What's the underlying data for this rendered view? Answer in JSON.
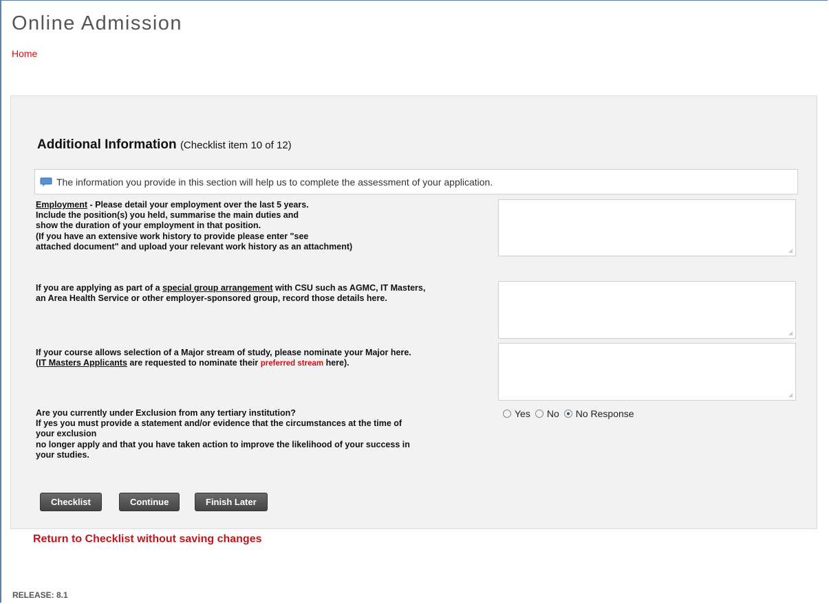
{
  "header": {
    "title": "Online Admission",
    "home_link": "Home"
  },
  "section": {
    "title": "Additional Information",
    "subtitle": "(Checklist item 10 of 12)",
    "info": "The information you provide in this section will help us to complete the assessment of your application."
  },
  "questions": {
    "employment": {
      "link": "Employment",
      "line1": " - Please detail your employment over the last 5 years.",
      "line2": "Include the position(s) you held, summarise the main duties and",
      "line3": "show the duration of your employment in that position.",
      "line4": "(If you have an extensive work history to provide please enter \"see",
      "line5": "attached document\" and upload your relevant work history as an attachment)",
      "value": ""
    },
    "special_group": {
      "prefix": "If you are applying as part of a ",
      "link": "special group arrangement",
      "suffix": " with CSU such as AGMC, IT Masters,",
      "line2": "an Area Health Service or other employer-sponsored group, record those details here.",
      "value": ""
    },
    "major": {
      "line1": "If your course allows selection of a Major stream of study, please nominate your Major here.",
      "prefix": "(",
      "link": "IT Masters Applicants",
      "middle": " are requested to nominate their ",
      "highlight": "preferred stream",
      "suffix": " here).",
      "value": ""
    },
    "exclusion": {
      "line1": "Are you currently under Exclusion from any tertiary institution?",
      "line2": "If yes you must provide a statement and/or evidence that the circumstances at the time of",
      "line3": "your exclusion",
      "line4": "no longer apply and that you have taken action to improve the likelihood of your success in",
      "line5": "your studies.",
      "options": [
        "Yes",
        "No",
        "No Response"
      ],
      "selected": "No Response"
    }
  },
  "buttons": {
    "checklist": "Checklist",
    "continue": "Continue",
    "finish_later": "Finish Later"
  },
  "return_link": "Return to Checklist without saving changes",
  "footer": {
    "release": "RELEASE: 8.1"
  },
  "colors": {
    "accent_red": "#c0161b",
    "button_dark": "#4d4d4d",
    "panel_bg": "#f2f2f2"
  }
}
